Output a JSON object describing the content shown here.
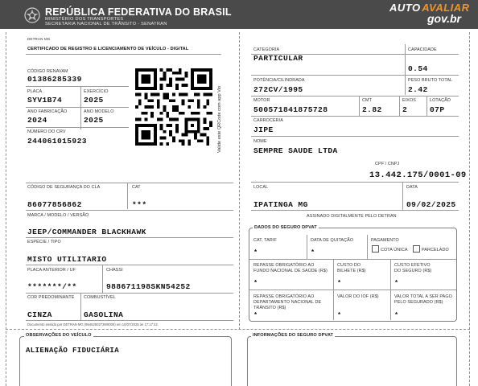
{
  "header": {
    "title": "REPÚBLICA FEDERATIVA DO BRASIL",
    "ministry": "MINISTÉRIO DOS TRANSPORTES",
    "secretariat": "SECRETARIA NACIONAL DE TRÂNSITO - SENATRAN",
    "brand_auto": "AUTO",
    "brand_avaliar": "AVALIAR",
    "brand_gov": "gov.br"
  },
  "document": {
    "issuer": "DETRAN  MG",
    "title": "CERTIFICADO DE REGISTRO E LICENCIAMENTO DE VEÍCULO - DIGITAL",
    "qr_caption": "Valide este QRCode com app Vio",
    "issued_note": "Documento emitido por DETRAN MG (95452502739/0000) em 10/07/2025 às 17:17:42."
  },
  "fields": {
    "renavam": {
      "label": "CÓDIGO RENAVAM",
      "value": "01386285339"
    },
    "placa": {
      "label": "PLACA",
      "value": "SYV1B74"
    },
    "exercicio": {
      "label": "EXERCÍCIO",
      "value": "2025"
    },
    "ano_fabricacao": {
      "label": "ANO FABRICAÇÃO",
      "value": "2024"
    },
    "ano_modelo": {
      "label": "ANO MODELO",
      "value": "2025"
    },
    "numero_crv": {
      "label": "NÚMERO DO CRV",
      "value": "244061015923"
    },
    "codigo_seguranca": {
      "label": "CÓDIGO DE SEGURANÇA DO CLA",
      "value": "86077856862"
    },
    "cat": {
      "label": "CAT",
      "value": "***"
    },
    "marca_modelo": {
      "label": "MARCA / MODELO / VERSÃO",
      "value": "JEEP/COMMANDER BLACKHAWK"
    },
    "especie_tipo": {
      "label": "ESPÉCIE / TIPO",
      "value": "MISTO UTILITARIO"
    },
    "placa_anterior": {
      "label": "PLACA ANTERIOR / UF",
      "value": "*******/**"
    },
    "chassi": {
      "label": "CHASSI",
      "value": "988671198SKN54252"
    },
    "cor": {
      "label": "COR PREDOMINANTE",
      "value": "CINZA"
    },
    "combustivel": {
      "label": "COMBUSTÍVEL",
      "value": "GASOLINA"
    },
    "categoria": {
      "label": "CATEGORIA",
      "value": "PARTICULAR"
    },
    "capacidade": {
      "label": "CAPACIDADE",
      "value": "0.54"
    },
    "potencia": {
      "label": "POTÊNCIA/CILINDRADA",
      "value": "272CV/1995"
    },
    "peso_bruto": {
      "label": "PESO BRUTO TOTAL",
      "value": "2.42"
    },
    "motor": {
      "label": "MOTOR",
      "value": "500571841875728"
    },
    "cmt": {
      "label": "CMT",
      "value": "2.82"
    },
    "eixos": {
      "label": "EIXOS",
      "value": "2"
    },
    "lotacao": {
      "label": "LOTAÇÃO",
      "value": "07P"
    },
    "carroceria": {
      "label": "CARROCERIA",
      "value": "JIPE"
    },
    "nome": {
      "label": "NOME",
      "value": "SEMPRE SAUDE LTDA"
    },
    "cpf_cnpj": {
      "label": "CPF / CNPJ",
      "value": "13.442.175/0001-09"
    },
    "local": {
      "label": "LOCAL",
      "value": "IPATINGA MG"
    },
    "data": {
      "label": "DATA",
      "value": "09/02/2025"
    },
    "signed": "ASSINADO DIGITALMENTE PELO DETRAN"
  },
  "dpvat": {
    "title": "DADOS DO SEGURO DPVAT",
    "cat_tarif": {
      "label": "CAT. TARIF",
      "value": "*"
    },
    "data_quitacao": {
      "label": "DATA DE QUITAÇÃO",
      "value": "*"
    },
    "pagamento": {
      "label": "PAGAMENTO",
      "opt1": "COTA ÚNICA",
      "opt2": "PARCELADO"
    },
    "repasse_fns": {
      "label1": "REPASSE OBRIGATÓRIO AO",
      "label2": "FUNDO NACIONAL DE SAÚDE (R$)",
      "value": "*"
    },
    "custo_bilhete": {
      "label1": "CUSTO DO",
      "label2": "BILHETE (R$)",
      "value": "*"
    },
    "custo_efetivo": {
      "label1": "CUSTO EFETIVO",
      "label2": "DO SEGURO (R$)",
      "value": "*"
    },
    "repasse_denatran": {
      "label1": "REPASSE OBRIGATÓRIO AO",
      "label2": "DEPARTAMENTO NACIONAL DE",
      "label3": "TRÂNSITO (R$)",
      "value": "*"
    },
    "valor_iof": {
      "label": "VALOR DO IOF (R$)",
      "value": "*"
    },
    "valor_total": {
      "label1": "VALOR TOTAL A SER PAGO",
      "label2": "PELO SEGURADO (R$)",
      "value": "*"
    }
  },
  "observacoes": {
    "title": "OBSERVAÇÕES DO VEÍCULO",
    "value": "ALIENAÇÃO FIDUCIÁRIA"
  },
  "informacoes": {
    "title": "INFORMAÇÕES DO SEGURO DPVAT"
  }
}
